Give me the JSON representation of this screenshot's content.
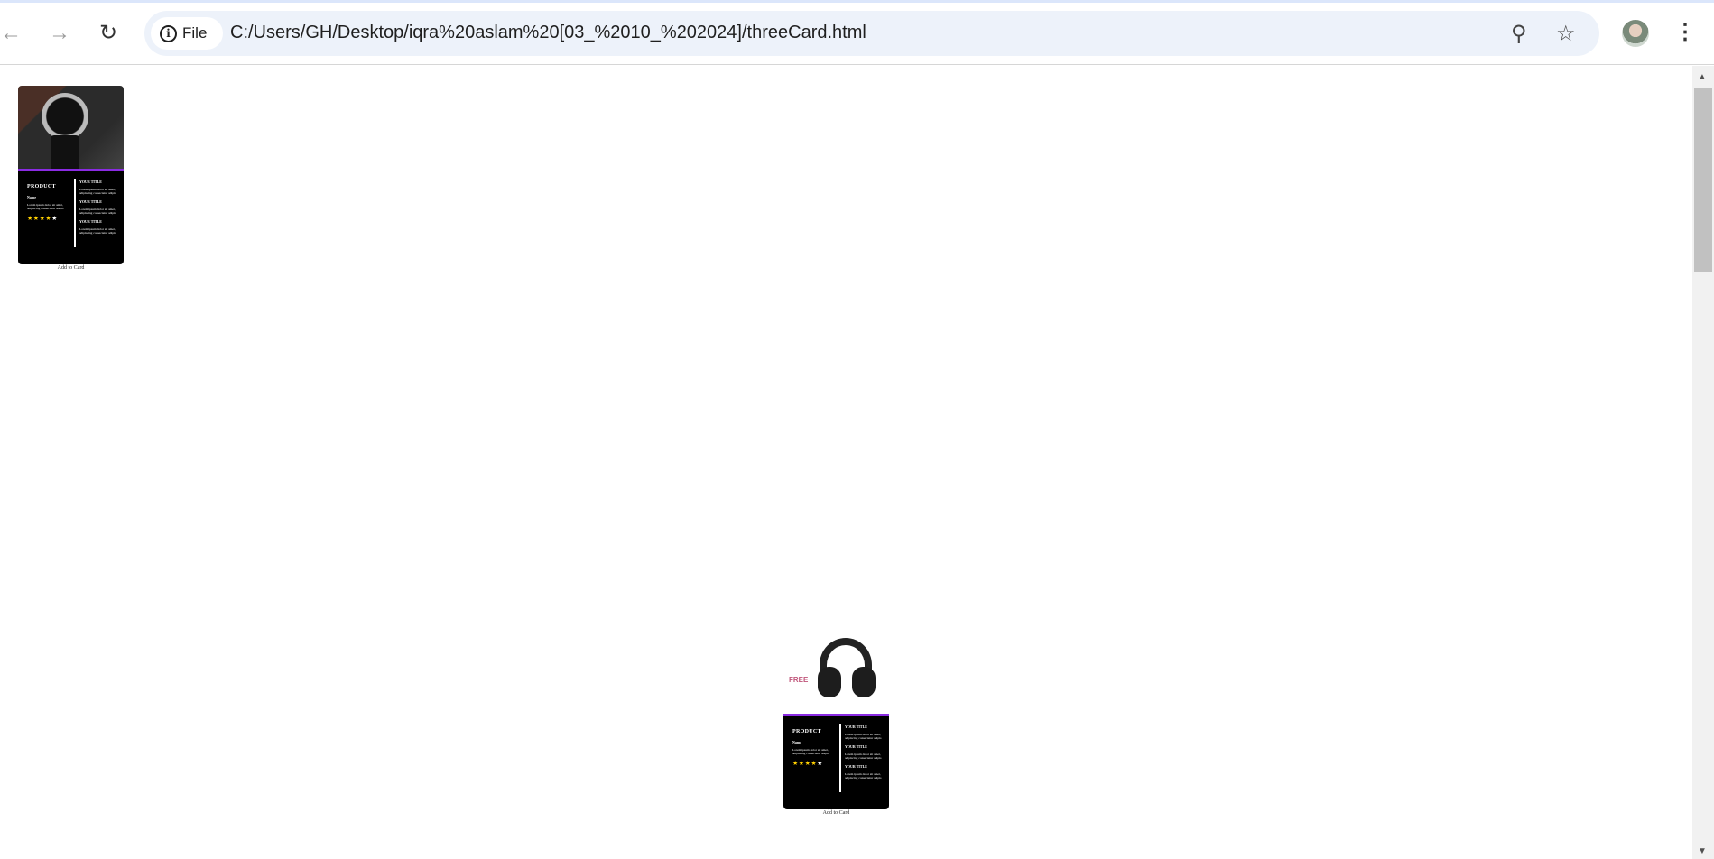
{
  "browser": {
    "chip_label": "File",
    "url": "C:/Users/GH/Desktop/iqra%20aslam%20[03_%2010_%202024]/threeCard.html"
  },
  "cards": [
    {
      "image": "wristwatch",
      "product": "PRODUCT",
      "name": "Name",
      "desc": "Lorem ipsum dolor sit amet, adipiscing consectetur adipis",
      "rating": 4,
      "rating_max": 5,
      "sections": [
        {
          "title": "YOUR TITLE",
          "text": "Lorem ipsum dolor sit amet, adipiscing consectetur adipis"
        },
        {
          "title": "YOUR TITLE",
          "text": "Lorem ipsum dolor sit amet, adipiscing consectetur adipis"
        },
        {
          "title": "YOUR TITLE",
          "text": "Lorem ipsum dolor sit amet, adipiscing consectetur adipis"
        }
      ],
      "button": "Add to Card"
    },
    {
      "image": "gaming-headset",
      "image_badge": "FREE",
      "product": "PRODUCT",
      "name": "Name",
      "desc": "Lorem ipsum dolor sit amet, adipiscing consectetur adipis",
      "rating": 4,
      "rating_max": 5,
      "sections": [
        {
          "title": "YOUR TITLE",
          "text": "Lorem ipsum dolor sit amet, adipiscing consectetur adipis"
        },
        {
          "title": "YOUR TITLE",
          "text": "Lorem ipsum dolor sit amet, adipiscing consectetur adipis"
        },
        {
          "title": "YOUR TITLE",
          "text": "Lorem ipsum dolor sit amet, adipiscing consectetur adipis"
        }
      ],
      "button": "Add to Card"
    }
  ],
  "colors": {
    "accent": "#8a2be2",
    "star": "#ffd000",
    "card_bg": "#000000"
  }
}
